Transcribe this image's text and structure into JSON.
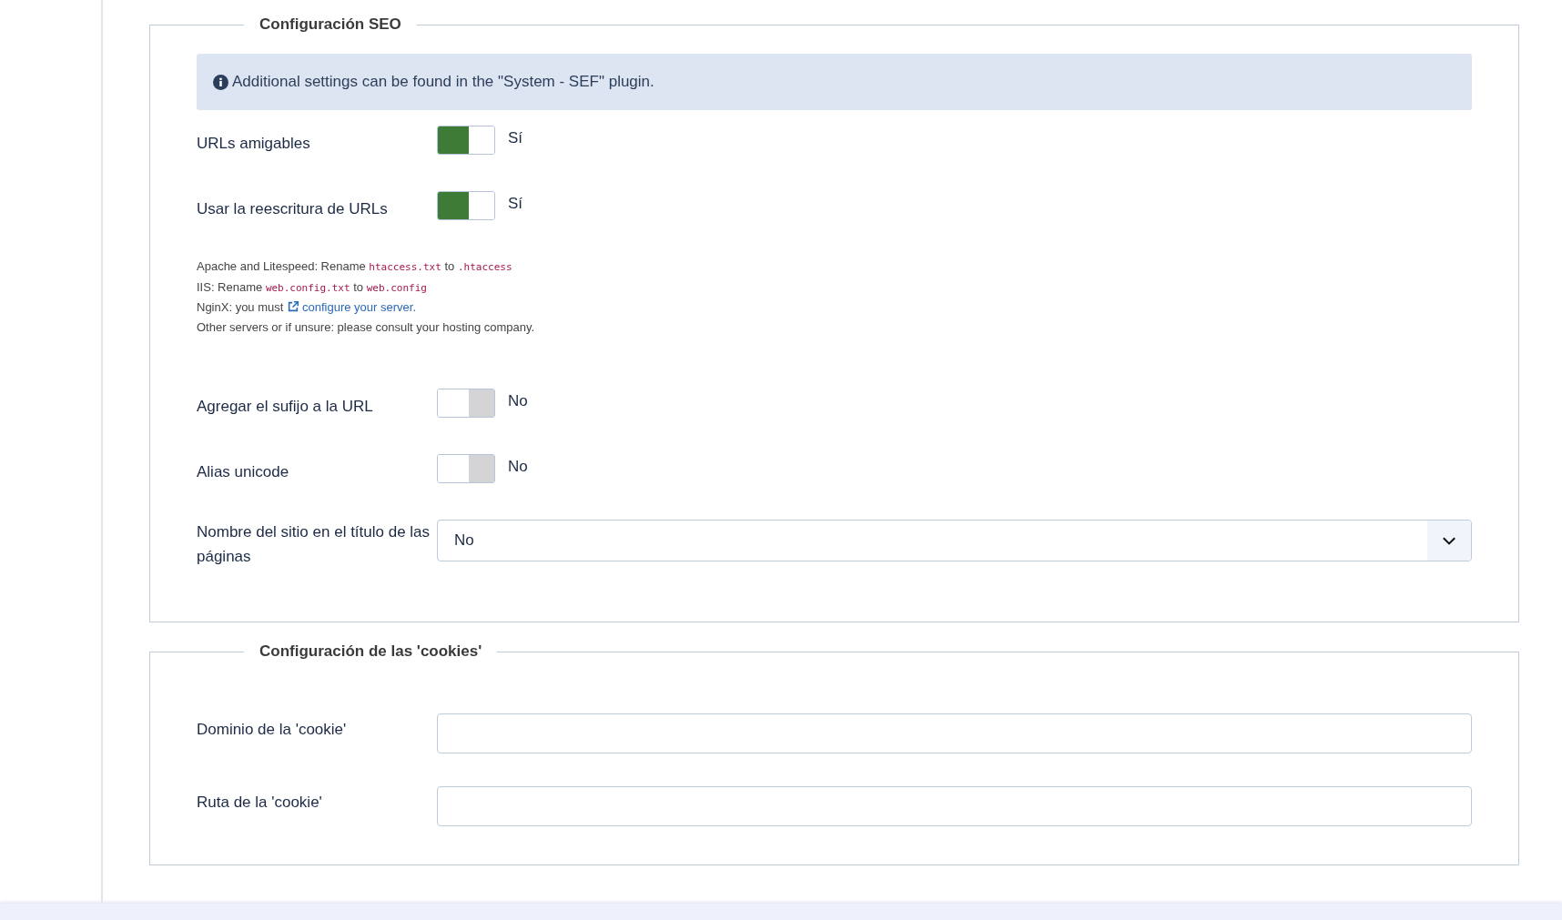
{
  "sections": [
    {
      "title": "Configuración SEO",
      "notice": {
        "text": "Additional settings can be found in the \"System - SEF\" plugin."
      },
      "fields": [
        {
          "kind": "toggle",
          "label": "URLs amigables",
          "on": true,
          "value": "Sí"
        },
        {
          "kind": "toggle",
          "label": "Usar la reescritura de URLs",
          "on": true,
          "value": "Sí"
        },
        {
          "kind": "help",
          "lines": [
            [
              {
                "kind": "text",
                "text": "Apache and Litespeed: Rename "
              },
              {
                "kind": "code",
                "text": "htaccess.txt"
              },
              {
                "kind": "text",
                "text": " to "
              },
              {
                "kind": "code",
                "text": ".htaccess"
              }
            ],
            [
              {
                "kind": "text",
                "text": "IIS: Rename "
              },
              {
                "kind": "code",
                "text": "web.config.txt"
              },
              {
                "kind": "text",
                "text": " to "
              },
              {
                "kind": "code",
                "text": "web.config"
              }
            ],
            [
              {
                "kind": "text",
                "text": "NginX: you must "
              },
              {
                "kind": "link",
                "text": "configure your server."
              }
            ],
            [
              {
                "kind": "text",
                "text": "Other servers or if unsure: please consult your hosting company."
              }
            ]
          ]
        },
        {
          "kind": "toggle",
          "label": "Agregar el sufijo a la URL",
          "on": false,
          "value": "No"
        },
        {
          "kind": "toggle",
          "label": "Alias unicode",
          "on": false,
          "value": "No"
        },
        {
          "kind": "select",
          "label": "Nombre del sitio en el título de las páginas",
          "value": "No"
        }
      ]
    },
    {
      "title": "Configuración de las 'cookies'",
      "fields": [
        {
          "kind": "text",
          "label": "Dominio de la 'cookie'"
        },
        {
          "kind": "text",
          "label": "Ruta de la 'cookie'"
        }
      ]
    }
  ]
}
